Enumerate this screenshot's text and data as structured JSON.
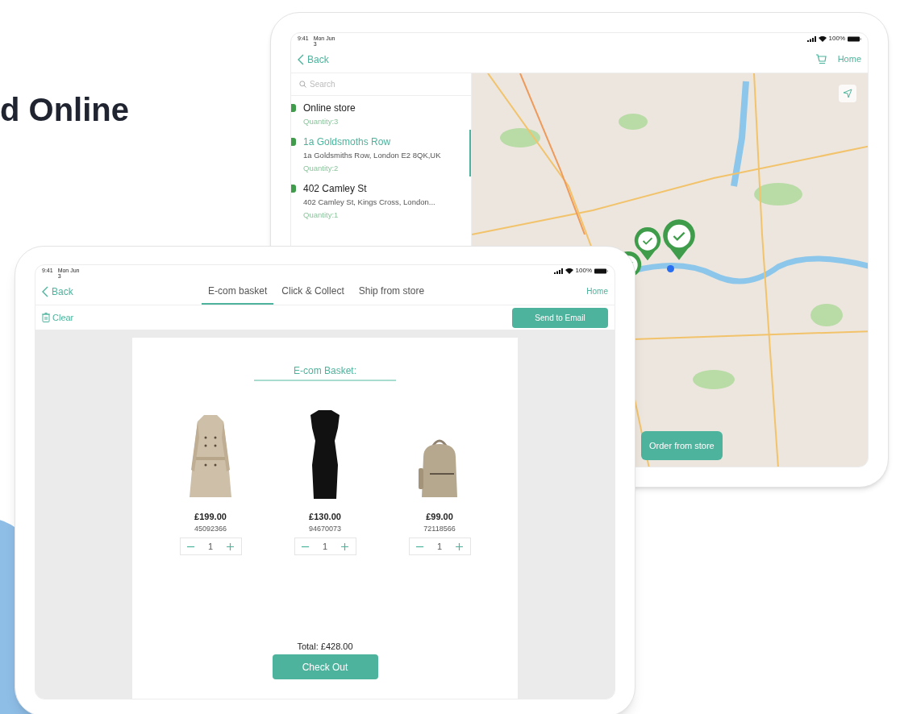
{
  "page_heading": "d Online",
  "back_tablet": {
    "status_bar": {
      "time": "9:41",
      "date": "Mon Jun 3",
      "battery": "100%"
    },
    "nav": {
      "back": "Back",
      "home": "Home"
    },
    "search": {
      "placeholder": "Search"
    },
    "stores": [
      {
        "name": "Online store",
        "quantity": "Quantity:3",
        "selected": false
      },
      {
        "name": "1a Goldsmoths Row",
        "address": "1a Goldsmiths Row, London E2 8QK,UK",
        "quantity": "Quantity:2",
        "selected": true
      },
      {
        "name": "402 Camley St",
        "address": "402 Camley St, Kings Cross, London...",
        "quantity": "Quantity:1",
        "selected": false
      }
    ],
    "map": {
      "order_button": "Order from store"
    }
  },
  "front_tablet": {
    "status_bar": {
      "time": "9:41",
      "date": "Mon Jun 3",
      "battery": "100%"
    },
    "nav": {
      "back": "Back",
      "home": "Home"
    },
    "tabs": [
      {
        "label": "E-com basket",
        "selected": true
      },
      {
        "label": "Click & Collect",
        "selected": false
      },
      {
        "label": "Ship from store",
        "selected": false
      }
    ],
    "toolbar": {
      "clear": "Clear",
      "send": "Send to Email"
    },
    "basket": {
      "title": "E-com Basket:",
      "products": [
        {
          "kind": "coat",
          "price": "£199.00",
          "code": "45092366",
          "quantity": "1"
        },
        {
          "kind": "dress",
          "price": "£130.00",
          "code": "94670073",
          "quantity": "1"
        },
        {
          "kind": "backpack",
          "price": "£99.00",
          "code": "72118566",
          "quantity": "1"
        }
      ],
      "total": "Total: £428.00",
      "checkout": "Check Out"
    }
  }
}
